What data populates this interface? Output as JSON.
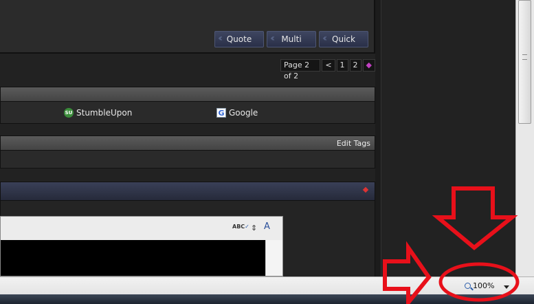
{
  "post": {
    "buttons": [
      {
        "label": "Quote"
      },
      {
        "label": "Multi"
      },
      {
        "label": "Quick"
      }
    ]
  },
  "pagination": {
    "label": "Page 2 of 2",
    "prev": "<",
    "pages": [
      "1",
      "2"
    ],
    "next": "◆"
  },
  "bookmarks": {
    "items": [
      {
        "label": "StumbleUpon",
        "icon": "stumbleupon-icon"
      },
      {
        "label": "Google",
        "icon": "google-icon"
      }
    ]
  },
  "tags": {
    "edit_label": "Edit Tags"
  },
  "editor": {
    "spell_icon": "ABC",
    "font_icon": "A"
  },
  "statusbar": {
    "zoom": "100%"
  },
  "colors": {
    "annotation": "#e8101a",
    "button_bg": "#2f3650"
  }
}
